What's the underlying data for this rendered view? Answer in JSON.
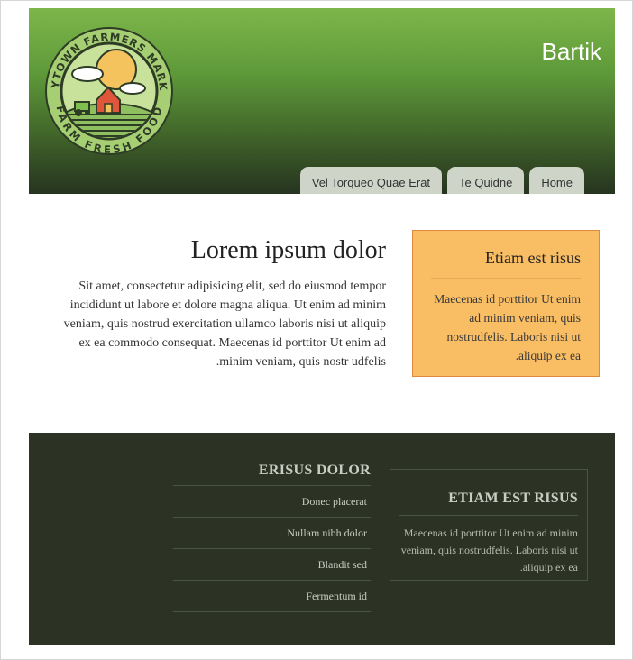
{
  "header": {
    "site_name": "Bartik",
    "logo_alt": "Anytown Farmers Market - Farm Fresh Food",
    "logo_top_text": "ANYTOWN FARMERS MARKET",
    "logo_bottom_text": "FARM FRESH FOOD",
    "tabs": [
      {
        "label": "Home"
      },
      {
        "label": "Te Quidne"
      },
      {
        "label": "Vel Torqueo Quae Erat"
      }
    ]
  },
  "main": {
    "title": "Lorem ipsum dolor",
    "body": "Sit amet, consectetur adipisicing elit, sed do eiusmod tempor incididunt ut labore et dolore magna aliqua. Ut enim ad minim veniam, quis nostrud exercitation ullamco laboris nisi ut aliquip ex ea commodo consequat. Maecenas id porttitor Ut enim ad .minim veniam, quis nostr udfelis"
  },
  "sidebar": {
    "title": "Etiam est risus",
    "body": "Maecenas id porttitor Ut enim ad minim veniam, quis nostrudfelis. Laboris nisi ut .aliquip ex ea"
  },
  "footer": {
    "menu_title": "ERISUS DOLOR",
    "menu_items": [
      {
        "label": "Donec placerat"
      },
      {
        "label": "Nullam nibh dolor"
      },
      {
        "label": "Blandit sed"
      },
      {
        "label": "Fermentum id"
      }
    ],
    "block_title": "ETIAM EST RISUS",
    "block_body": "Maecenas id porttitor Ut enim ad minim veniam, quis nostrudfelis. Laboris nisi ut .aliquip ex ea"
  },
  "colors": {
    "header_top": "#7db64a",
    "header_bottom": "#263420",
    "sidebar_bg": "#f9bd63",
    "footer_bg": "#2c3324"
  }
}
